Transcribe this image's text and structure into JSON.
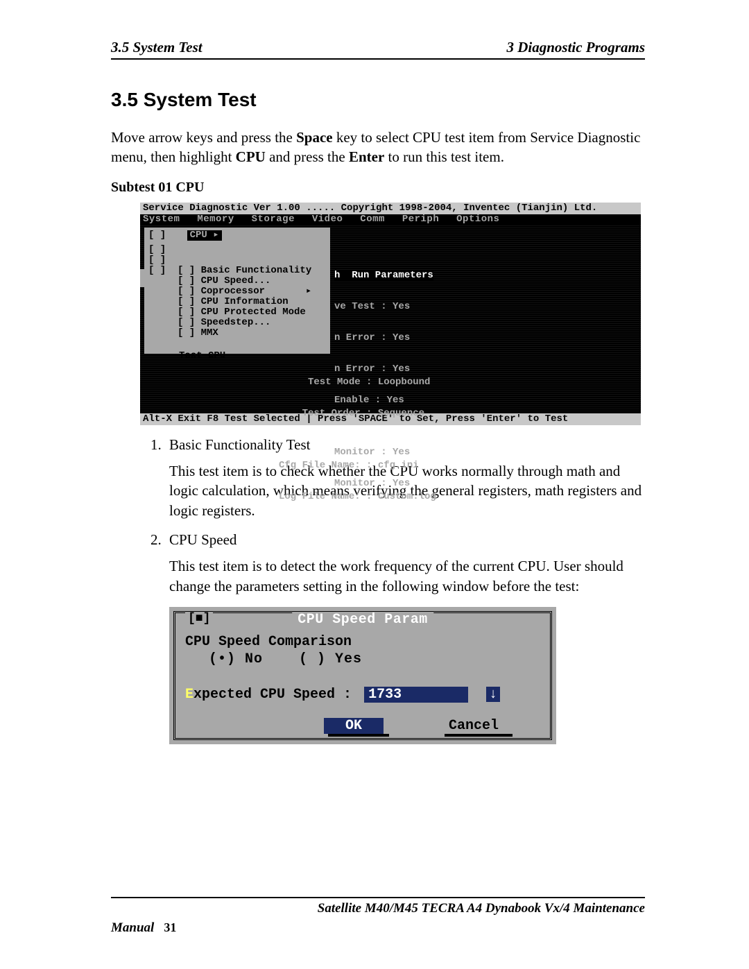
{
  "header": {
    "left": "3.5 System Test",
    "right": "3  Diagnostic Programs"
  },
  "section_title": "3.5    System Test",
  "intro_parts": {
    "p1": "Move arrow keys and press the ",
    "space": "Space",
    "p2": " key to select CPU test item from Service Diagnostic menu, then highlight ",
    "cpu": "CPU",
    "p3": " and press the ",
    "enter": "Enter",
    "p4": " to run this test item."
  },
  "subtest_label": "Subtest 01 CPU",
  "diag": {
    "title": "Service Diagnostic Ver 1.00 .....  Copyright 1998-2004, Inventec (Tianjin) Ltd.",
    "menus": [
      "System",
      "Memory",
      "Storage",
      "Video",
      "Comm",
      "Periph",
      "Options"
    ],
    "cpu_hi": "CPU     ▸",
    "left_items": [
      "[ ]",
      "[ ]",
      "[ ]  [ ] Basic Functionality",
      "     [ ] CPU Speed...",
      "     [ ] Coprocessor       ▸",
      "     [ ] CPU Information",
      "     [ ] CPU Protected Mode",
      "     [ ] Speedstep...",
      "     [ ] MMX"
    ],
    "test_cpu": "Test CPU",
    "params_hdr": "h  Run Parameters",
    "params_rows": [
      "ve Test : Yes",
      "n Error : Yes",
      "n Error : Yes",
      "Enable : Yes",
      "",
      "Monitor : Yes",
      "Monitor : Yes"
    ],
    "bottom_rows": [
      "     Test Mode : Loopbound",
      "    Test Order : Sequence",
      "",
      "Cfg File Name: : cfg.ini",
      "Log File Name: : Custom.log"
    ],
    "status": "Alt-X Exit   F8 Test Selected  |  Press 'SPACE' to Set, Press 'Enter' to Test"
  },
  "list": [
    {
      "title": "Basic Functionality Test",
      "body": "This test item is to check whether the CPU works normally through math and logic calculation, which means verifying the general registers, math registers and logic registers."
    },
    {
      "title": "CPU Speed",
      "body": "This test item is to detect the work frequency of the current CPU. User should change the parameters setting in the following window before the test:"
    }
  ],
  "speed": {
    "title": "CPU Speed Param",
    "close": "[■]",
    "label_comparison": "CPU Speed Comparison",
    "radio_no": "(•) No",
    "radio_yes": "( ) Yes",
    "expected_lbl": "Expected CPU Speed :",
    "expected_val": "1733",
    "spin": "↓",
    "ok": "OK",
    "cancel": "Cancel"
  },
  "footer1": "Satellite M40/M45 TECRA A4 Dynabook Vx/4  Maintenance",
  "footer2": {
    "label": "Manual",
    "page": "31"
  }
}
